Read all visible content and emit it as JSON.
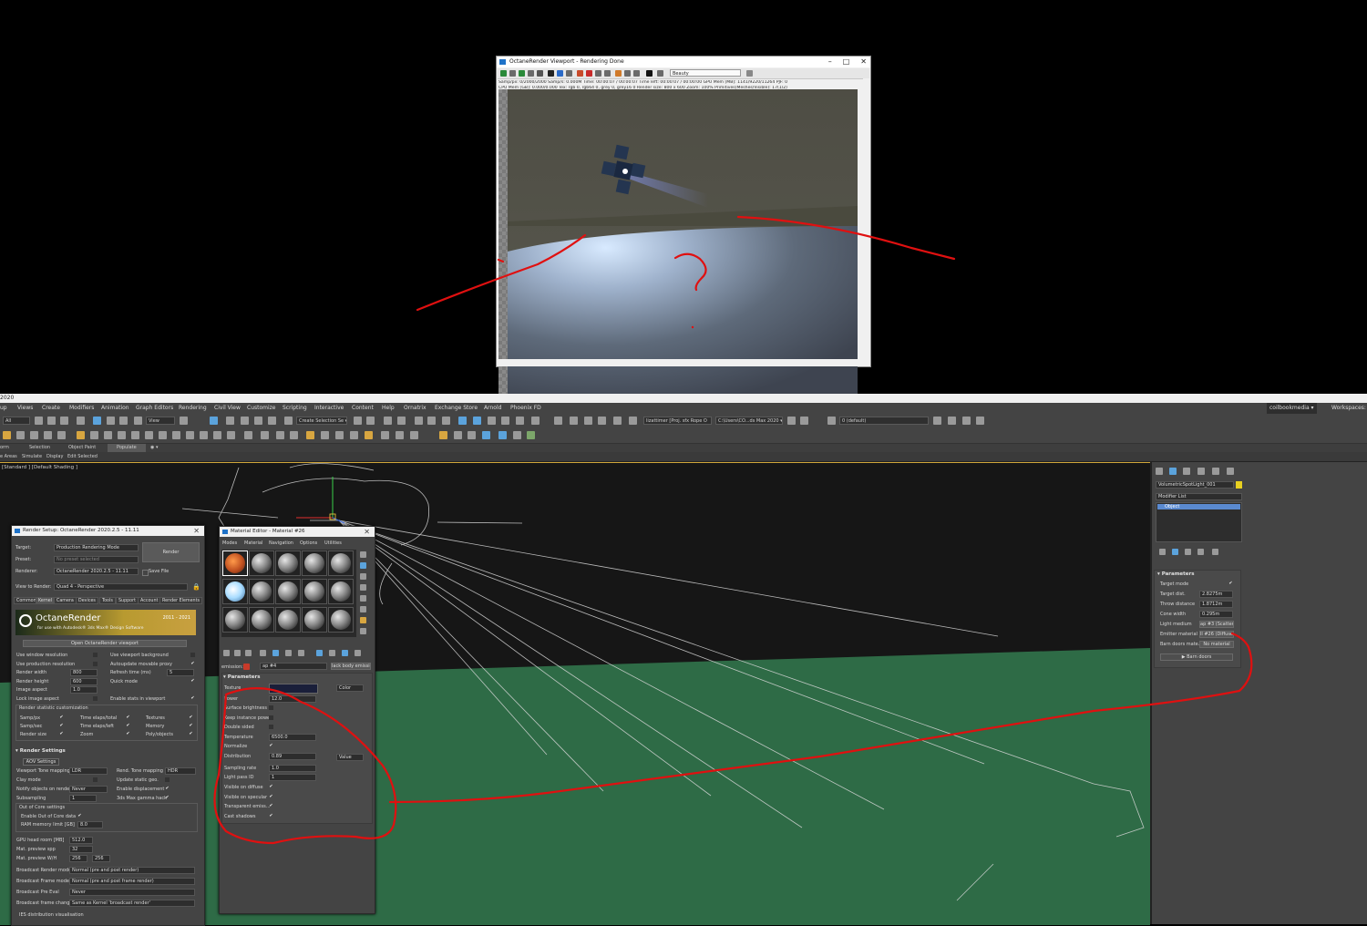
{
  "octane_viewport": {
    "title": "OctaneRender Viewport - Rendering Done",
    "window_buttons": [
      "–",
      "□",
      "✕"
    ],
    "pass_select": "Beauty",
    "stats_line1": "Samp/px: 0/2000/2000     Samp/s: 0.000M    Time: 00:00:07 / 00:00:07     Time left: 00:00:07 / 00:00:00     GPU Mem [MB]: 1141/9220/11264 PJF: 0",
    "stats_line2": "CPU Mem [GB]: 0.000/0.000    Tex: rgb 0, rgb64 0, grey 0, grey16 0     Render size: 800 x 600     Zoom: 100%     Primitives(Meshes/Visible): 17(1/2)"
  },
  "max": {
    "title_text": "2020",
    "menus": [
      "up",
      "Views",
      "Create",
      "Modifiers",
      "Animation",
      "Graph Editors",
      "Rendering",
      "Civil View",
      "Customize",
      "Scripting",
      "Interactive",
      "Content",
      "Help",
      "Ornatrix",
      "Exchange Store",
      "Arnold",
      "Phoenix FD"
    ],
    "user": "coilbookmedia ▾",
    "workspaces_label": "Workspaces: De",
    "toolbar": {
      "filter": "All",
      "view": "View",
      "selection_set": "Create Selection Se ▾",
      "path1": "lizattimer [Proj. sfx Rope O",
      "path2": "C:\\Users\\CO...ds Max 2020 ▾",
      "layer": "0 (default)"
    },
    "ribbon_tabs": [
      "orm",
      "Selection",
      "Object Paint",
      "Populate",
      "◉ ▾"
    ],
    "ribbon_sub": [
      "e Areas",
      "Simulate",
      "Display",
      "Edit Selected"
    ],
    "viewport_label": "[Standard ] [Default Shading ]"
  },
  "command_panel": {
    "object_name": "VolumetricSpotLight_001",
    "object_color": "#e8d020",
    "modifier_list": "Modifier List",
    "stack_item": "Object",
    "rollout": "Parameters",
    "params": [
      {
        "label": "Target mode",
        "value": "✔"
      },
      {
        "label": "Target dist.",
        "value": "2.8275m"
      },
      {
        "label": "Throw distance",
        "value": "1.8712m"
      },
      {
        "label": "Cone width",
        "value": "0.295m"
      },
      {
        "label": "Light medium",
        "value": "ap #3 (Scatteri"
      },
      {
        "label": "Emitter material",
        "value": "ll #26 (Diffuse n"
      },
      {
        "label": "Barn doors mate.",
        "value": "No material"
      }
    ],
    "barn_doors_button": "▶ Barn doors"
  },
  "render_setup": {
    "title": "Render Setup: OctaneRender 2020.2.5 - 11.11",
    "target_label": "Target:",
    "target_value": "Production Rendering Mode",
    "preset_label": "Preset:",
    "preset_value": "No preset selected",
    "renderer_label": "Renderer:",
    "renderer_value": "OctaneRender 2020.2.5 - 11.11",
    "save_file": "Save File",
    "render_button": "Render",
    "view_label": "View to Render:",
    "view_value": "Quad 4 - Perspective",
    "tabs": [
      "Common",
      "Kernel",
      "Camera",
      "Devices",
      "Tools",
      "Support",
      "Account",
      "Render Elements"
    ],
    "banner_title": "OctaneRender",
    "banner_sub": "for use with Autodesk® 3ds Max® Design Software",
    "banner_years": "2011 - 2021",
    "open_viewport": "Open OctaneRender viewport",
    "rows_left": [
      {
        "label": "Use window resolution",
        "value": ""
      },
      {
        "label": "Use production resolution",
        "value": ""
      },
      {
        "label": "Render width",
        "value": "800"
      },
      {
        "label": "Render height",
        "value": "600"
      },
      {
        "label": "Image aspect",
        "value": "1.0"
      },
      {
        "label": "Lock image aspect",
        "value": ""
      }
    ],
    "rows_right": [
      {
        "label": "Use viewport background",
        "value": ""
      },
      {
        "label": "Autoupdate movable proxy",
        "value": "✔"
      },
      {
        "label": "Refresh time (ms)",
        "value": "5"
      },
      {
        "label": "Quick mode",
        "value": "✔"
      },
      {
        "label": "",
        "value": ""
      },
      {
        "label": "Enable stats in viewport",
        "value": "✔"
      }
    ],
    "stat_title": "Render statistic customization",
    "stat_items": [
      [
        "Samp/px",
        "Time elaps/total",
        "Textures"
      ],
      [
        "Samp/sec",
        "Time elaps/left",
        "Memory"
      ],
      [
        "Render size",
        "Zoom",
        "Poly/objects"
      ]
    ],
    "render_settings": "Render Settings",
    "aov_settings": "AOV Settings",
    "settings_left": [
      {
        "label": "Viewport Tone mapping",
        "value": "LDR"
      },
      {
        "label": "Clay mode",
        "value": ""
      },
      {
        "label": "Notify objects on render",
        "value": "Never"
      },
      {
        "label": "Subsampling",
        "value": "1"
      }
    ],
    "settings_right": [
      {
        "label": "Rend. Tone mapping",
        "value": "HDR"
      },
      {
        "label": "Update static geo.",
        "value": ""
      },
      {
        "label": "Enable displacement",
        "value": "✔"
      },
      {
        "label": "3ds Max gamma hack",
        "value": "✔"
      }
    ],
    "ooc_title": "Out of Core settings",
    "ooc_enable": "Enable Out of Core data",
    "ooc_ram": "RAM memory limit [GB]",
    "ooc_ram_value": "8.0",
    "gpu_rows": [
      {
        "label": "GPU head room [MB]",
        "value": "512.0"
      },
      {
        "label": "Mat. preview spp",
        "value": "32"
      },
      {
        "label": "Mat. preview W/H",
        "value": "256",
        "value2": "256"
      }
    ],
    "broadcast_rows": [
      {
        "label": "Broadcast Render mode",
        "value": "Normal (pre and post render)"
      },
      {
        "label": "Broadcast Frame mode",
        "value": "Normal (pre and post frame render)"
      },
      {
        "label": "Broadcast Pre Eval",
        "value": "Never"
      },
      {
        "label": "Broadcast frame change",
        "value": "Same as Kernel 'broadcast render'"
      }
    ],
    "ies": "IES distribution visualisation"
  },
  "material_editor": {
    "title": "Material Editor - Material #26",
    "menus": [
      "Modes",
      "Material",
      "Navigation",
      "Options",
      "Utilities"
    ],
    "slot_label": "emission:",
    "slot_value": "ap #4",
    "type_button": "lack body emissior",
    "rollout": "Parameters",
    "texture_label": "Texture",
    "color_select": "Color",
    "rows": [
      {
        "label": "Power",
        "value": "12.0"
      },
      {
        "label": "Surface brightness",
        "value": ""
      },
      {
        "label": "Keep instance power",
        "value": ""
      },
      {
        "label": "Double sided",
        "value": ""
      },
      {
        "label": "Temperature",
        "value": "6500.0"
      },
      {
        "label": "Normalize",
        "value": "✔"
      },
      {
        "label": "Distribution",
        "value": "0.89"
      },
      {
        "label": "Sampling rate",
        "value": "1.0"
      },
      {
        "label": "Light pass ID",
        "value": "1"
      },
      {
        "label": "Visible on diffuse",
        "value": "✔"
      },
      {
        "label": "Visible on specular",
        "value": "✔"
      },
      {
        "label": "Transparent emiss...",
        "value": "✔"
      },
      {
        "label": "Cast shadows",
        "value": "✔"
      }
    ],
    "value_select": "Value"
  },
  "annotation": {
    "question_mark": "?",
    "stroke_color": "#e01010"
  }
}
